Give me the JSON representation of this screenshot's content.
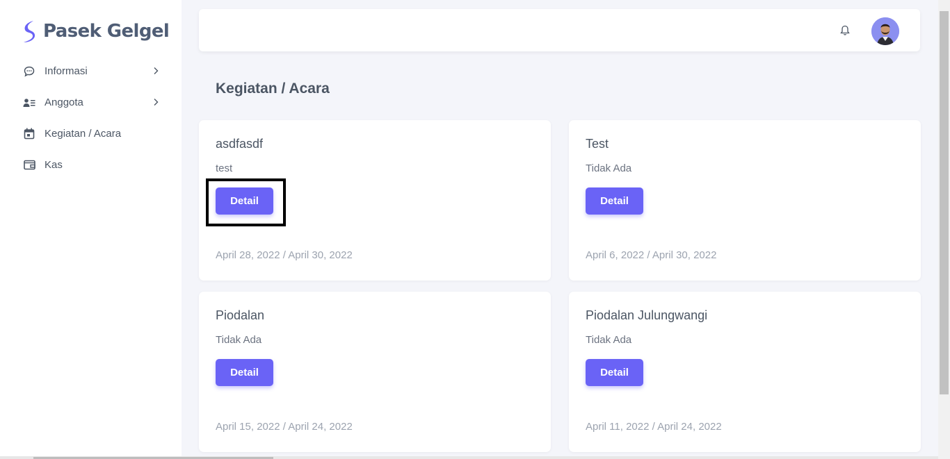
{
  "app": {
    "brand_name": "Pasek Gelgel",
    "accent_color": "#6a63f6"
  },
  "sidebar": {
    "items": [
      {
        "label": "Informasi",
        "icon": "chat-bubble-icon",
        "has_chevron": true
      },
      {
        "label": "Anggota",
        "icon": "members-list-icon",
        "has_chevron": true
      },
      {
        "label": "Kegiatan / Acara",
        "icon": "calendar-icon",
        "has_chevron": false
      },
      {
        "label": "Kas",
        "icon": "wallet-icon",
        "has_chevron": false
      }
    ]
  },
  "header": {
    "notification_icon": "bell-icon",
    "avatar": "user-avatar"
  },
  "main": {
    "title": "Kegiatan / Acara",
    "cards": [
      {
        "title": "asdfasdf",
        "description": "test",
        "button_label": "Detail",
        "dates": "April 28, 2022 / April 30, 2022"
      },
      {
        "title": "Test",
        "description": "Tidak Ada",
        "button_label": "Detail",
        "dates": "April 6, 2022 / April 30, 2022"
      },
      {
        "title": "Piodalan",
        "description": "Tidak Ada",
        "button_label": "Detail",
        "dates": "April 15, 2022 / April 24, 2022"
      },
      {
        "title": "Piodalan Julungwangi",
        "description": "Tidak Ada",
        "button_label": "Detail",
        "dates": "April 11, 2022 / April 24, 2022"
      }
    ]
  }
}
